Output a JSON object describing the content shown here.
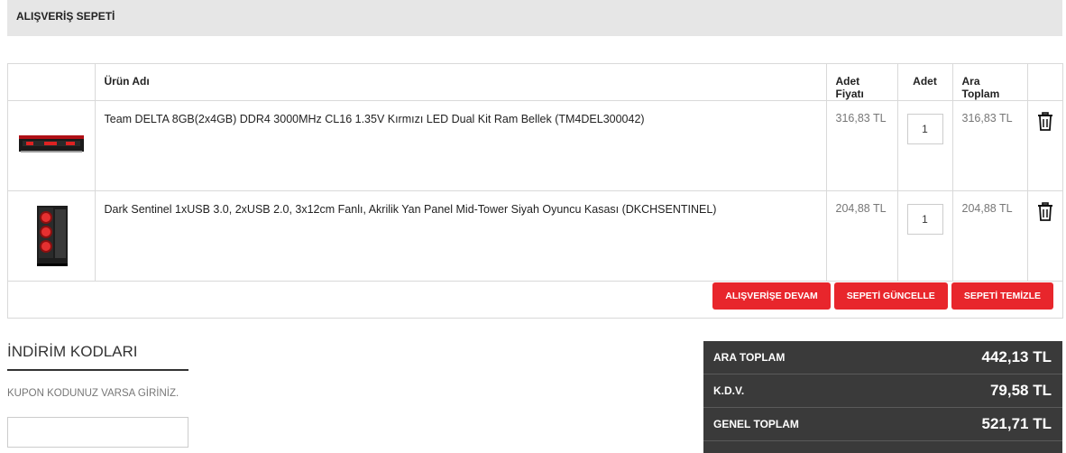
{
  "header": {
    "title": "ALIŞVERİŞ SEPETİ"
  },
  "cart": {
    "columns": {
      "image": "",
      "name": "Ürün Adı",
      "unit_price": "Adet Fiyatı",
      "qty": "Adet",
      "subtotal": "Ara Toplam"
    },
    "items": [
      {
        "image_icon": "ram-module-image",
        "name": "Team DELTA 8GB(2x4GB) DDR4 3000MHz CL16 1.35V Kırmızı LED Dual Kit Ram Bellek (TM4DEL300042)",
        "unit_price": "316,83 TL",
        "qty": "1",
        "subtotal": "316,83 TL",
        "delete_icon": "trash-icon"
      },
      {
        "image_icon": "pc-case-image",
        "name": "Dark Sentinel 1xUSB 3.0, 2xUSB 2.0, 3x12cm Fanlı, Akrilik Yan Panel Mid-Tower Siyah Oyuncu Kasası (DKCHSENTINEL)",
        "unit_price": "204,88 TL",
        "qty": "1",
        "subtotal": "204,88 TL",
        "delete_icon": "trash-icon"
      }
    ],
    "buttons": {
      "continue": "ALIŞVERİŞE DEVAM",
      "update": "SEPETİ GÜNCELLE",
      "clear": "SEPETİ TEMİZLE"
    }
  },
  "discount": {
    "title": "İNDİRİM KODLARI",
    "hint": "KUPON KODUNUZ VARSA GİRİNİZ.",
    "input_value": ""
  },
  "totals": {
    "subtotal_label": "ARA TOPLAM",
    "subtotal_value": "442,13 TL",
    "tax_label": "K.D.V.",
    "tax_value": "79,58 TL",
    "grand_label": "GENEL TOPLAM",
    "grand_value": "521,71 TL"
  },
  "colors": {
    "accent": "#e8262c",
    "totals_bg": "#3a3a3a",
    "header_bg": "#e6e6e6"
  }
}
